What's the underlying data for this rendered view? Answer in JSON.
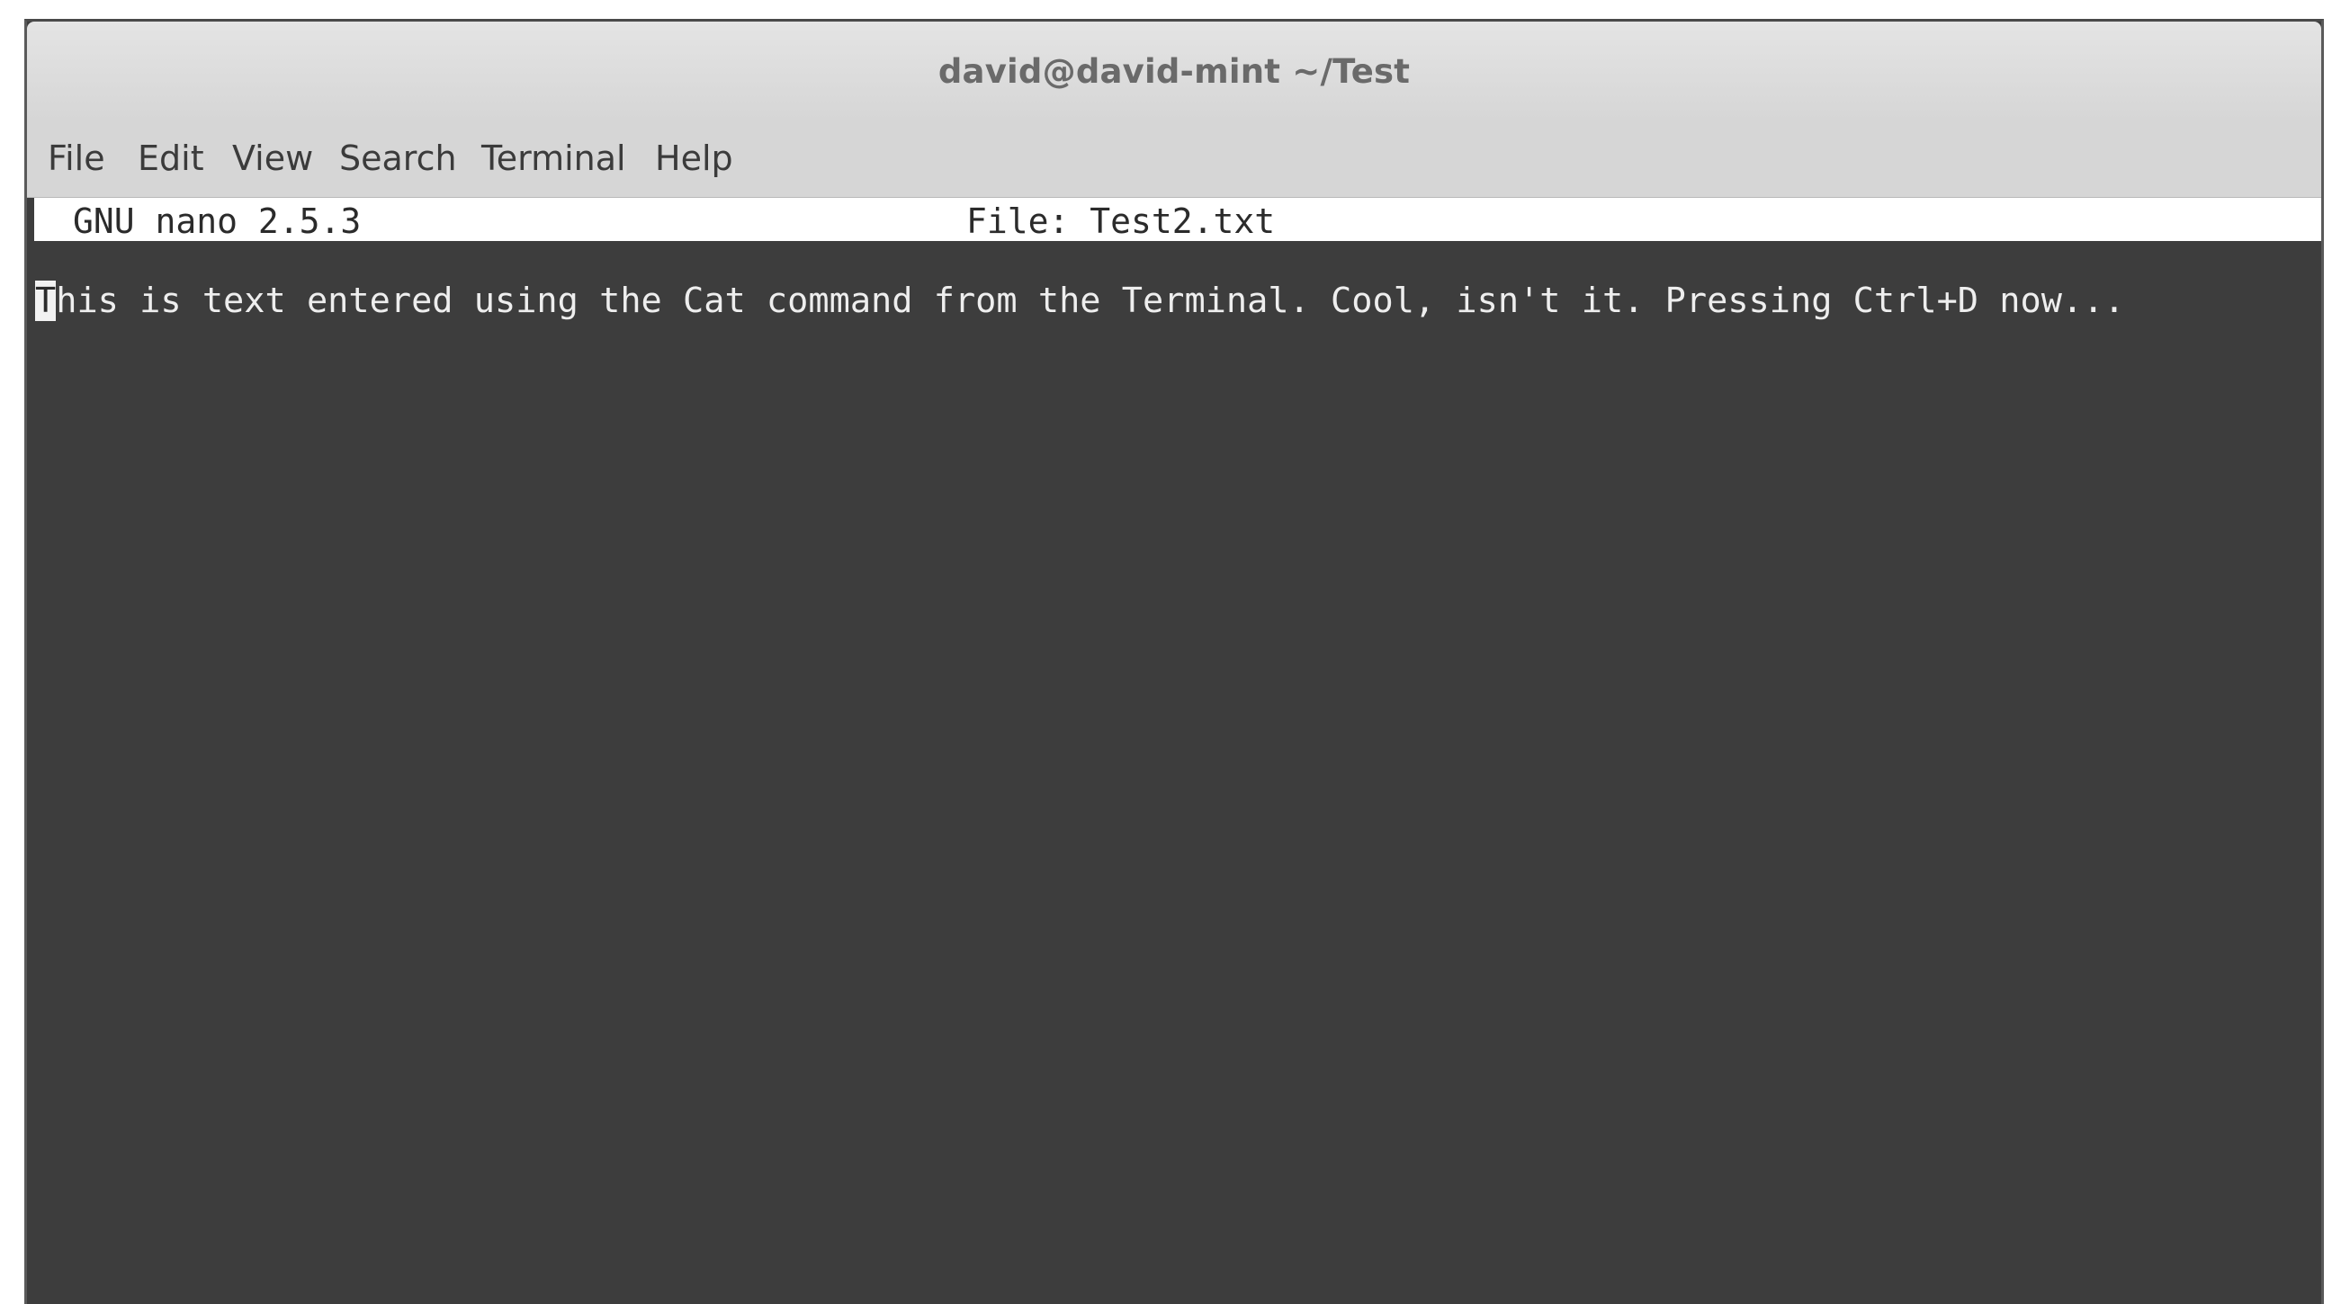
{
  "window": {
    "title": "david@david-mint ~/Test"
  },
  "menu": {
    "items": [
      "File",
      "Edit",
      "View",
      "Search",
      "Terminal",
      "Help"
    ]
  },
  "nano": {
    "version": "GNU nano 2.5.3",
    "file_label": "File: Test2.txt"
  },
  "editor": {
    "cursor_char": "T",
    "line_rest": "his is text entered using the Cat command from the Terminal. Cool, isn't it. Pressing Ctrl+D now..."
  },
  "colors": {
    "terminal_background": "#3d3d3d",
    "text": "#eeeeee",
    "menubar": "#d6d6d6",
    "header_background": "#ffffff"
  }
}
